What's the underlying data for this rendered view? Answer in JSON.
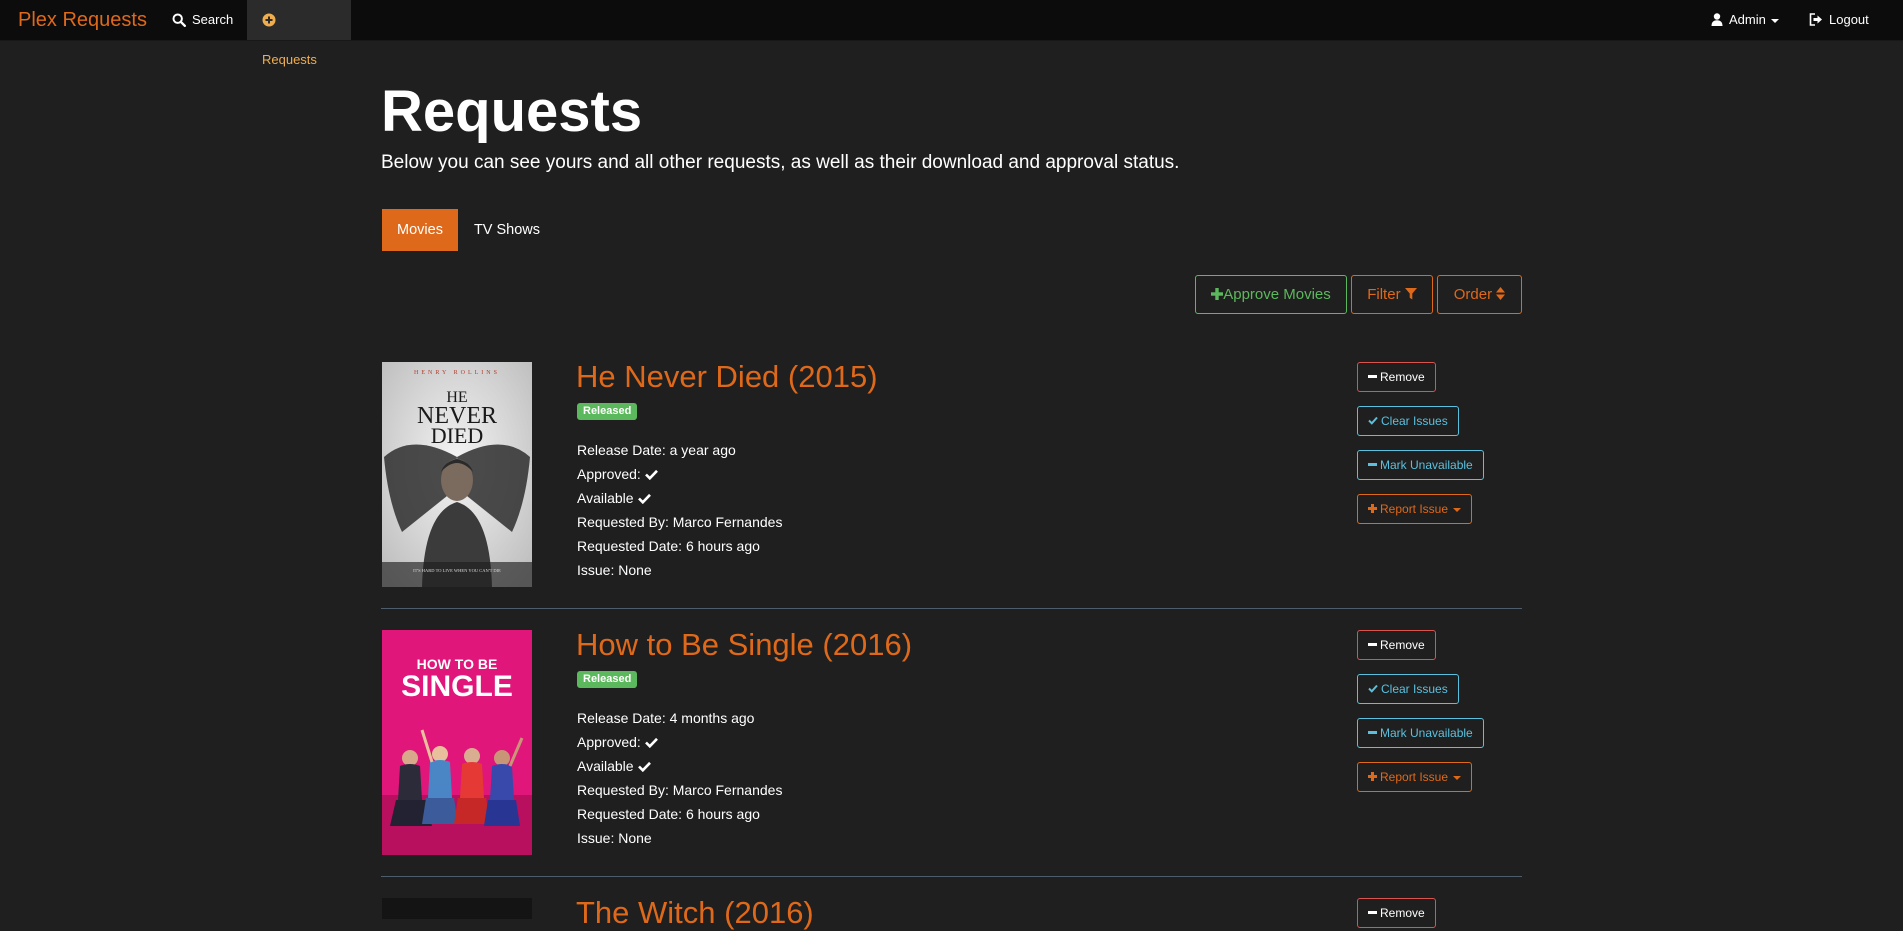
{
  "navbar": {
    "brand": "Plex Requests",
    "search_label": "Search",
    "requests_label": "Requests",
    "user_label": "Admin",
    "logout_label": "Logout"
  },
  "page": {
    "title": "Requests",
    "lead": "Below you can see yours and all other requests, as well as their download and approval status."
  },
  "tabs": [
    "Movies",
    "TV Shows"
  ],
  "toolbar": {
    "approve_label": "Approve Movies",
    "filter_label": "Filter",
    "order_label": "Order"
  },
  "movies": [
    {
      "title": "He Never Died (2015)",
      "status": "Released",
      "release_date": "Release Date: a year ago",
      "approved": "Approved:",
      "available": "Available",
      "requested_by": "Requested By: Marco Fernandes",
      "requested_date": "Requested Date: 6 hours ago",
      "issue": "Issue: None",
      "poster": {
        "top_credit": "HENRY ROLLINS",
        "title_lines": [
          "HE",
          "NEVER",
          "DIED"
        ],
        "tagline": "IT'S HARD TO LIVE WHEN YOU CAN'T DIE"
      }
    },
    {
      "title": "How to Be Single (2016)",
      "status": "Released",
      "release_date": "Release Date: 4 months ago",
      "approved": "Approved:",
      "available": "Available",
      "requested_by": "Requested By: Marco Fernandes",
      "requested_date": "Requested Date: 6 hours ago",
      "issue": "Issue: None",
      "poster": {
        "title_lines": [
          "HOW TO BE",
          "SINGLE"
        ]
      }
    },
    {
      "title": "The Witch (2016)"
    }
  ],
  "actions": {
    "remove": "Remove",
    "clear_issues": "Clear Issues",
    "mark_unavailable": "Mark Unavailable",
    "report_issue": "Report Issue"
  },
  "colors": {
    "accent": "#df691a",
    "success": "#5cb85c",
    "info": "#5bc0de",
    "danger": "#d9534f",
    "background": "#1f1f1f",
    "navbar": "#0c0c0c"
  }
}
